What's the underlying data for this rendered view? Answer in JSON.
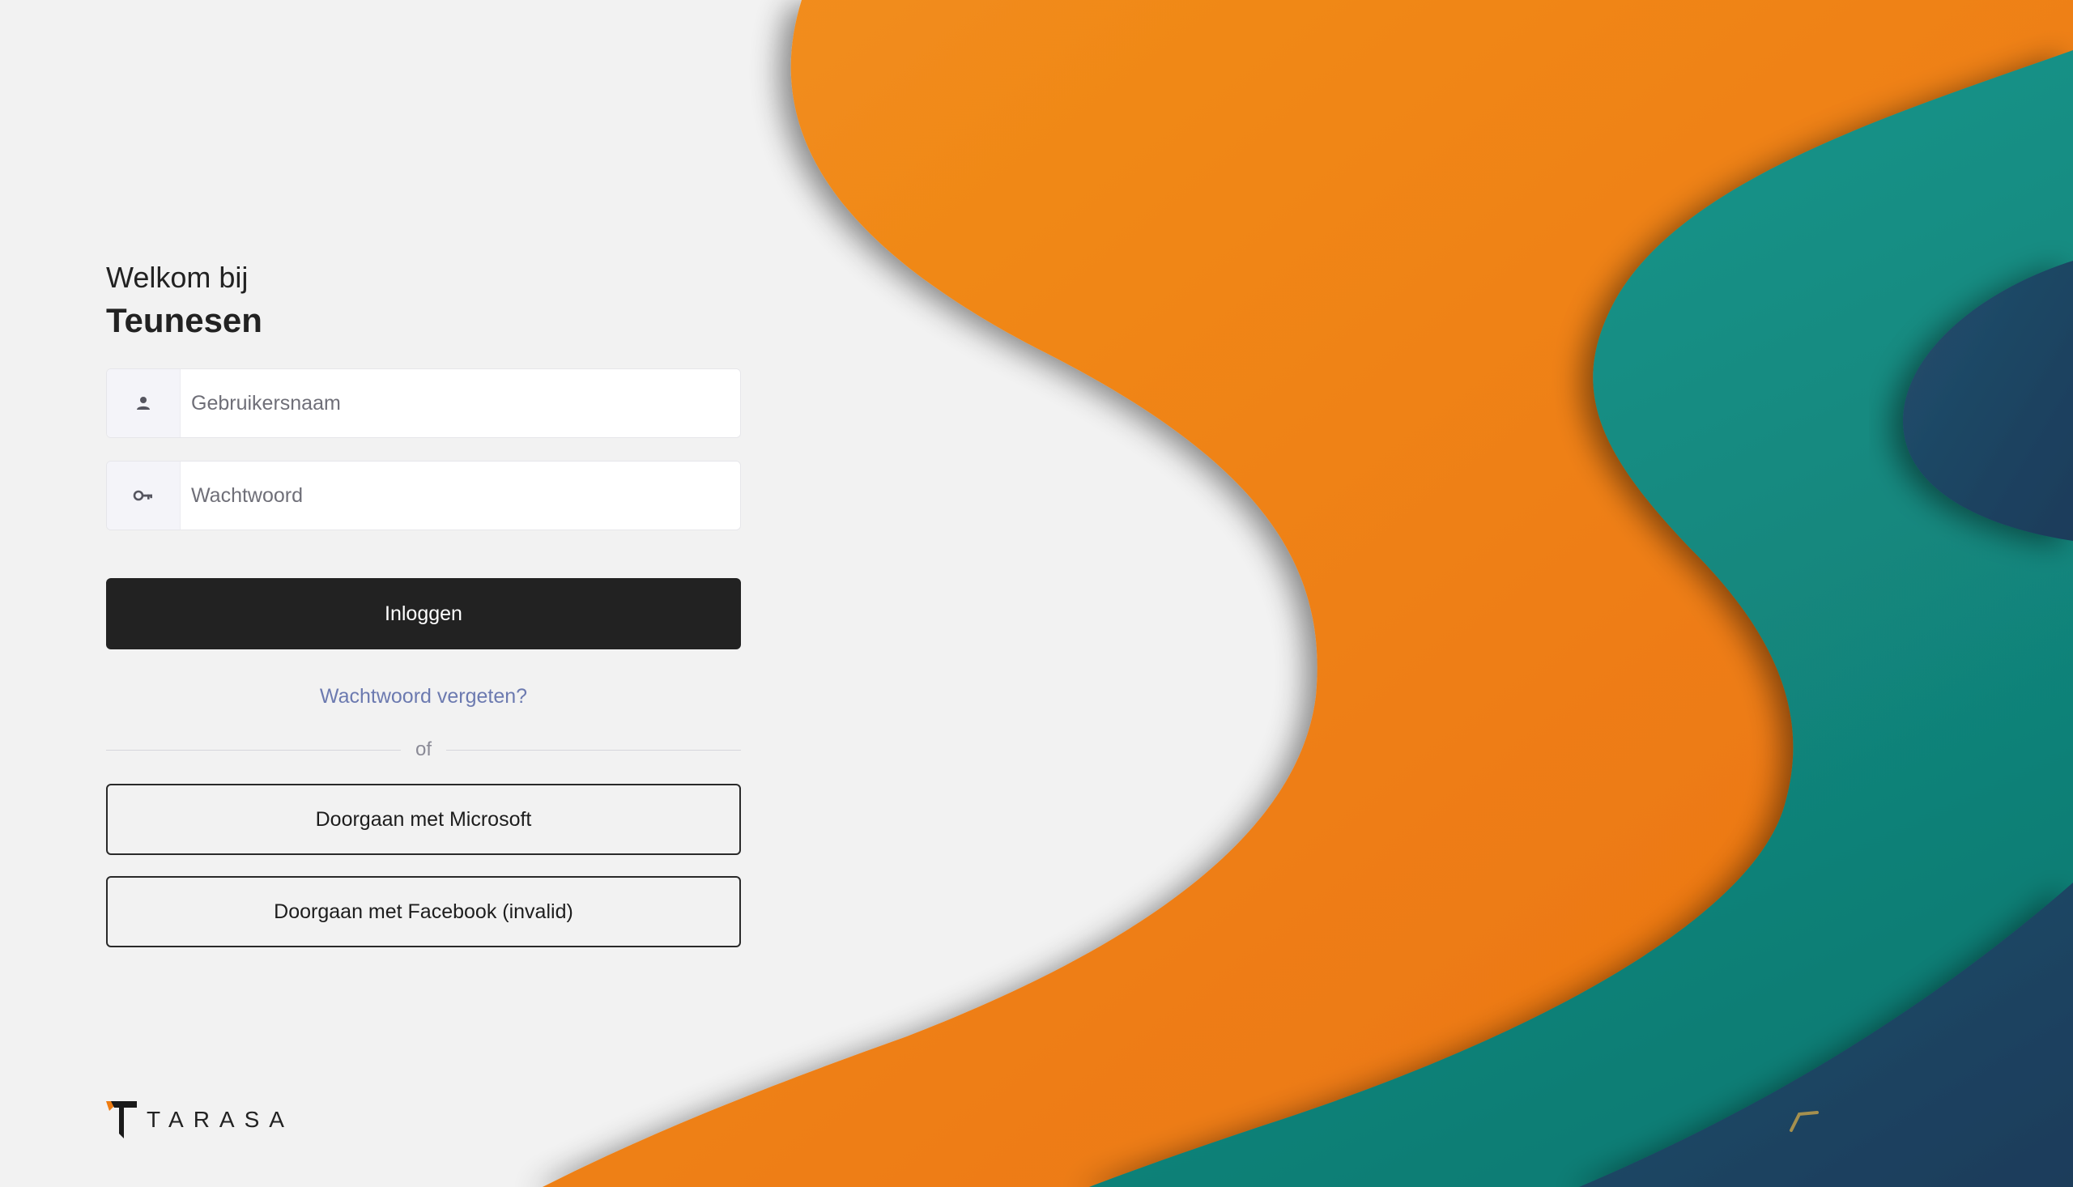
{
  "login": {
    "welcome": "Welkom bij",
    "brand": "Teunesen",
    "username_placeholder": "Gebruikersnaam",
    "password_placeholder": "Wachtwoord",
    "login_button": "Inloggen",
    "forgot_password": "Wachtwoord vergeten?",
    "divider_text": "of",
    "microsoft_button": "Doorgaan met Microsoft",
    "facebook_button": "Doorgaan met Facebook (invalid)"
  },
  "icons": {
    "username": "user-icon",
    "password": "key-icon"
  },
  "footer": {
    "logo_text": "TARASA"
  },
  "colors": {
    "background": "#f2f2f2",
    "primary_button": "#222222",
    "link": "#6c7ab0",
    "orange": "#ee7c12",
    "teal": "#139389",
    "navy": "#1f4766"
  }
}
